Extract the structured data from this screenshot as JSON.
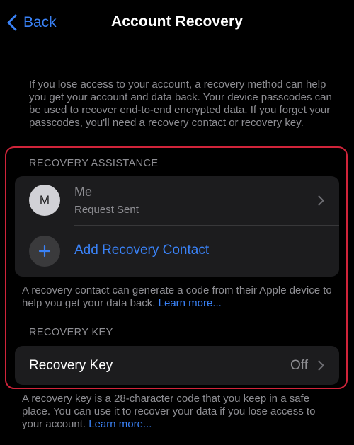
{
  "nav": {
    "back_label": "Back",
    "title": "Account Recovery"
  },
  "intro_text": "If you lose access to your account, a recovery method can help you get your account and data back. Your device passcodes can be used to recover end-to-end encrypted data. If you forget your passcodes, you'll need a recovery contact or recovery key.",
  "recovery_assistance": {
    "header": "RECOVERY ASSISTANCE",
    "contact": {
      "avatar_initial": "M",
      "name": "Me",
      "status": "Request Sent"
    },
    "add_contact_label": "Add Recovery Contact",
    "footer_text": "A recovery contact can generate a code from their Apple device to help you get your data back.",
    "footer_link": "Learn more..."
  },
  "recovery_key": {
    "header": "RECOVERY KEY",
    "label": "Recovery Key",
    "value": "Off",
    "footer_text": "A recovery key is a 28-character code that you keep in a safe place. You can use it to recover your data if you lose access to your account.",
    "footer_link": "Learn more..."
  },
  "colors": {
    "accent": "#3a82f7",
    "highlight_border": "#d0243a",
    "card_bg": "#1c1c1e",
    "secondary_text": "#8e8e93"
  }
}
